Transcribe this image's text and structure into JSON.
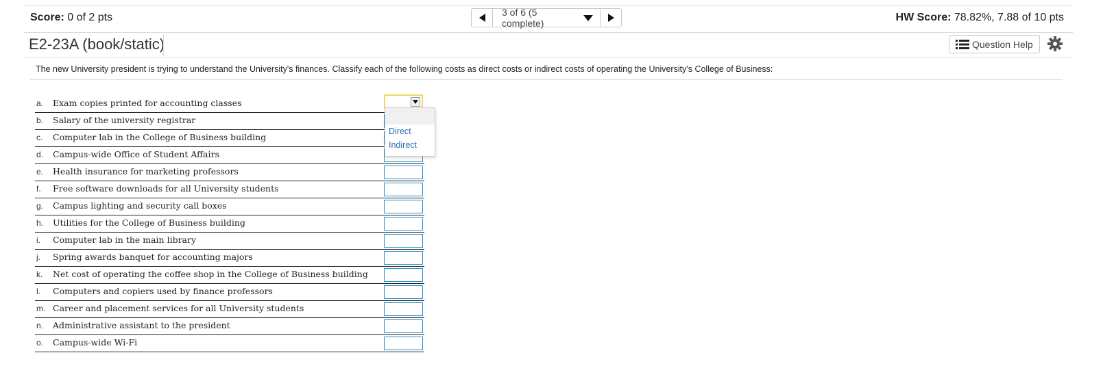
{
  "header": {
    "score_label": "Score:",
    "score_value": " 0 of 2 pts",
    "pager_text": "3 of 6 (5 complete)",
    "hw_label": "HW Score:",
    "hw_value": " 78.82%, 7.88 of 10 pts"
  },
  "question": {
    "title": "E2-23A (book/static)",
    "help_label": "Question Help",
    "prompt": "The new University president is trying to understand the University's finances. Classify each of the following costs as direct costs or indirect costs of operating the University's College of Business:"
  },
  "items": [
    {
      "letter": "a.",
      "text": "Exam copies printed for accounting classes"
    },
    {
      "letter": "b.",
      "text": "Salary of the university registrar"
    },
    {
      "letter": "c.",
      "text": "Computer lab in the College of Business building"
    },
    {
      "letter": "d.",
      "text": "Campus-wide Office of Student Affairs"
    },
    {
      "letter": "e.",
      "text": "Health insurance for marketing professors"
    },
    {
      "letter": "f.",
      "text": "Free software downloads for all University students"
    },
    {
      "letter": "g.",
      "text": "Campus lighting and security call boxes"
    },
    {
      "letter": "h.",
      "text": "Utilities for the College of Business building"
    },
    {
      "letter": "i.",
      "text": "Computer lab in the main library"
    },
    {
      "letter": "j.",
      "text": "Spring awards banquet for accounting majors"
    },
    {
      "letter": "k.",
      "text": "Net cost of operating the coffee shop in the College of Business building"
    },
    {
      "letter": "l.",
      "text": "Computers and copiers used by finance professors"
    },
    {
      "letter": "m.",
      "text": "Career and placement services for all University students"
    },
    {
      "letter": "n.",
      "text": "Administrative assistant to the president"
    },
    {
      "letter": "o.",
      "text": "Campus-wide Wi-Fi"
    }
  ],
  "dropdown": {
    "options": [
      "Direct",
      "Indirect"
    ]
  },
  "icons": {
    "prev": "chevron-left-icon",
    "next": "chevron-right-icon",
    "pager_menu": "caret-down-icon",
    "help": "list-icon",
    "settings": "gear-icon"
  }
}
